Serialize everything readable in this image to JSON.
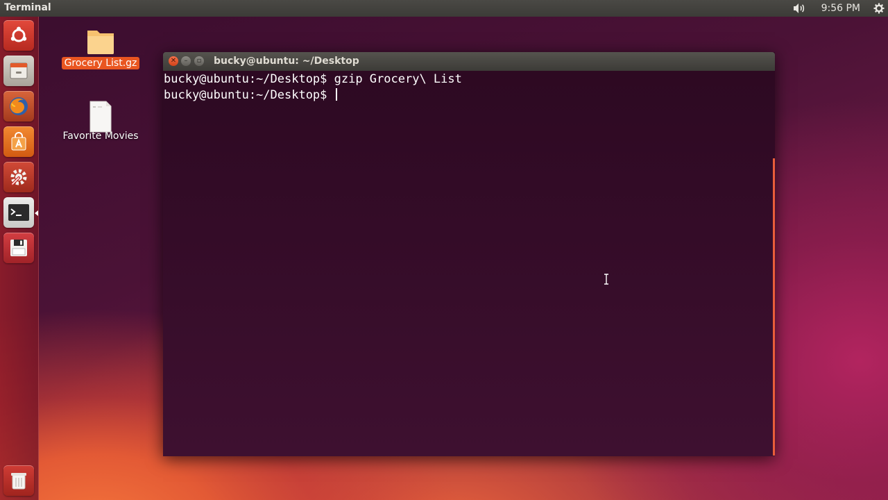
{
  "top_panel": {
    "app_title": "Terminal",
    "clock": "9:56 PM",
    "volume_icon": "volume-icon",
    "settings_icon": "gear-icon"
  },
  "launcher": {
    "items": [
      {
        "name": "dash-home",
        "icon": "ubuntu-logo-icon"
      },
      {
        "name": "files",
        "icon": "file-cabinet-icon"
      },
      {
        "name": "firefox",
        "icon": "firefox-icon"
      },
      {
        "name": "software-center",
        "icon": "shopping-bag-icon"
      },
      {
        "name": "system-settings",
        "icon": "settings-wrench-icon"
      },
      {
        "name": "terminal",
        "icon": "terminal-icon",
        "active": true
      },
      {
        "name": "save",
        "icon": "floppy-disk-icon"
      },
      {
        "name": "trash",
        "icon": "trash-icon"
      }
    ]
  },
  "desktop": {
    "icons": [
      {
        "label": "Grocery List.gz",
        "selected": true
      },
      {
        "label": "Favorite Movies",
        "selected": false
      }
    ]
  },
  "terminal": {
    "title": "bucky@ubuntu: ~/Desktop",
    "lines": [
      "bucky@ubuntu:~/Desktop$ gzip Grocery\\ List",
      "bucky@ubuntu:~/Desktop$ "
    ]
  },
  "colors": {
    "accent": "#e95621",
    "terminal_bg": "#300a24",
    "panel_bg": "#3c3b37"
  }
}
